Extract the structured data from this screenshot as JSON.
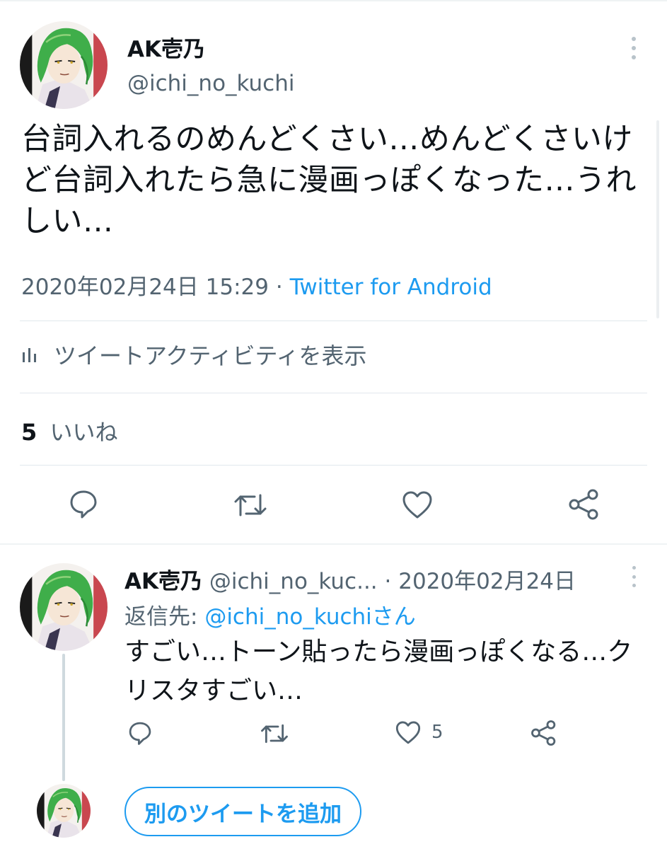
{
  "colors": {
    "accent": "#1d9bf0",
    "secondary_text": "#536471",
    "primary_text": "#0f1419",
    "divider": "#e1e8ed"
  },
  "tweet": {
    "author_name": "AK壱乃",
    "author_handle": "@ichi_no_kuchi",
    "text": "台詞入れるのめんどくさい…めんどくさいけど台詞入れたら急に漫画っぽくなった…うれしい…",
    "timestamp": "2020年02月24日 15:29",
    "separator": "·",
    "source": "Twitter for Android",
    "activity_label": "ツイートアクティビティを表示",
    "like_count": "5",
    "like_label": "いいね",
    "actions": [
      "reply-icon",
      "retweet-icon",
      "like-icon",
      "share-icon"
    ]
  },
  "reply": {
    "author_name": "AK壱乃",
    "author_handle": "@ichi_no_kuc...",
    "separator": "·",
    "date": "2020年02月24日",
    "reply_to_prefix": "返信先: ",
    "reply_to_mention": "@ichi_no_kuchiさん",
    "text": "すごい…トーン貼ったら漫画っぽくなる…クリスタすごい…",
    "like_count": "5",
    "actions": [
      "reply-icon",
      "retweet-icon",
      "like-icon",
      "share-icon"
    ]
  },
  "compose": {
    "add_tweet_label": "別のツイートを追加"
  }
}
